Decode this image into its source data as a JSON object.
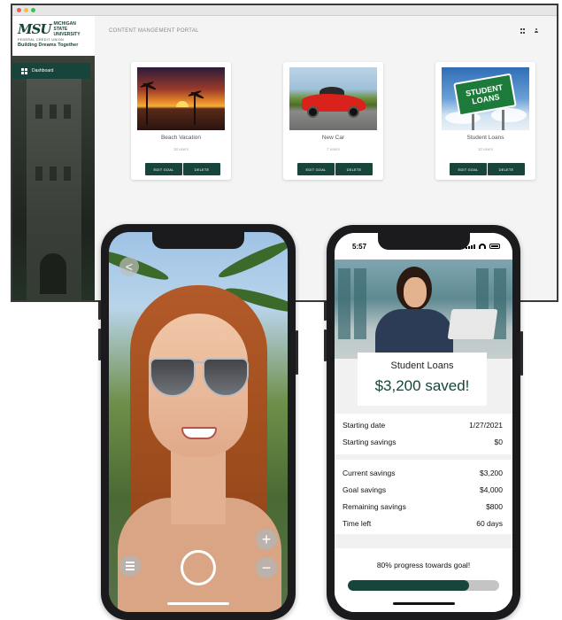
{
  "desktop": {
    "logo": {
      "brand": "MSU",
      "line1": "MICHIGAN",
      "line2": "STATE",
      "line3": "UNIVERSITY",
      "sub": "FEDERAL CREDIT UNION",
      "tagline": "Building Dreams Together"
    },
    "sidebar": {
      "items": [
        {
          "label": "Dashboard",
          "icon": "dashboard-icon"
        }
      ]
    },
    "header": {
      "title": "CONTENT MANGEMENT PORTAL"
    },
    "cards": [
      {
        "title": "Beach Vacation",
        "users": "18 users",
        "image": "beach-sunset-image"
      },
      {
        "title": "New Car",
        "users": "7 users",
        "image": "red-car-image"
      },
      {
        "title": "Student Loans",
        "users": "10 users",
        "image": "student-loans-sign-image",
        "sign_line1": "STUDENT",
        "sign_line2": "LOANS"
      }
    ],
    "buttons": {
      "edit": "EDIT GOAL",
      "delete": "DELETE"
    }
  },
  "camera_phone": {
    "back": "<",
    "zoom_in": "+",
    "zoom_out": "−"
  },
  "goal_phone": {
    "status_time": "5:57",
    "goal_title": "Student Loans",
    "saved_text": "$3,200 saved!",
    "rows_top": [
      {
        "label": "Starting date",
        "value": "1/27/2021"
      },
      {
        "label": "Starting savings",
        "value": "$0"
      }
    ],
    "rows_bottom": [
      {
        "label": "Current savings",
        "value": "$3,200"
      },
      {
        "label": "Goal savings",
        "value": "$4,000"
      },
      {
        "label": "Remaining savings",
        "value": "$800"
      },
      {
        "label": "Time left",
        "value": "60 days"
      }
    ],
    "progress_text": "80% progress towards goal!",
    "progress_value": 0.8
  },
  "colors": {
    "brand_green": "#18453b"
  }
}
